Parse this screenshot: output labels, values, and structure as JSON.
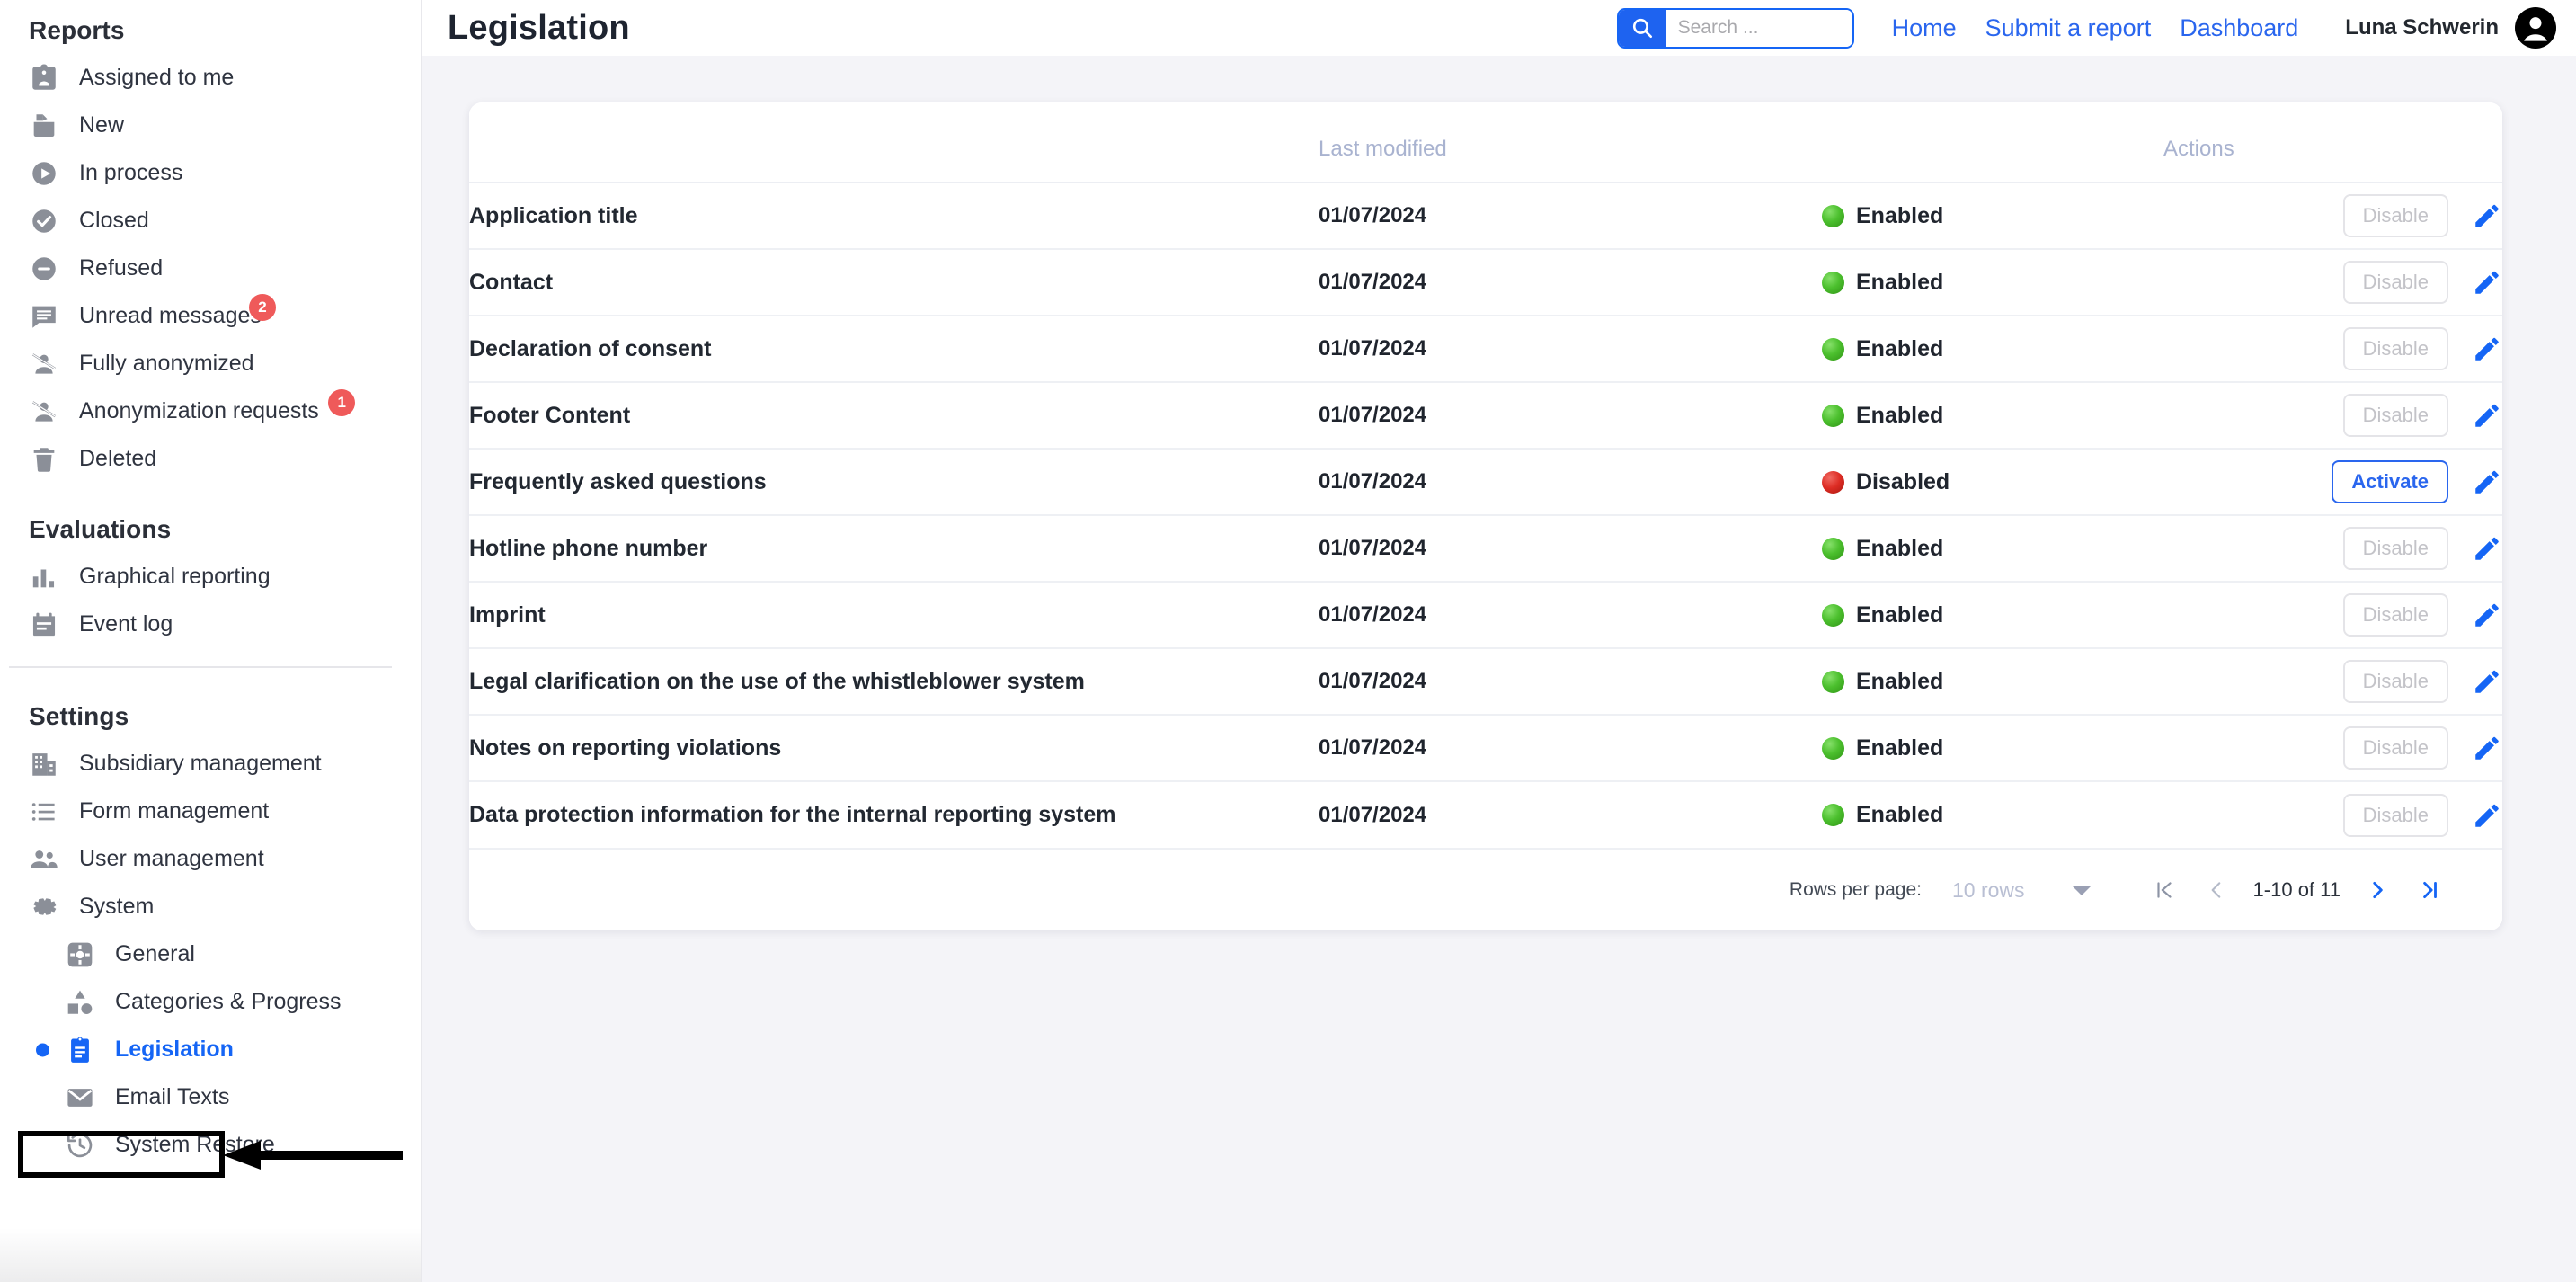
{
  "sidebar": {
    "sections": [
      {
        "heading": "Reports",
        "items": [
          {
            "label": "Assigned to me",
            "icon": "assigned-badge-icon"
          },
          {
            "label": "New",
            "icon": "inbox-new-icon"
          },
          {
            "label": "In process",
            "icon": "play-circle-icon"
          },
          {
            "label": "Closed",
            "icon": "check-circle-icon"
          },
          {
            "label": "Refused",
            "icon": "minus-circle-icon"
          },
          {
            "label": "Unread messages",
            "icon": "chat-message-icon",
            "badge": "2"
          },
          {
            "label": "Fully anonymized",
            "icon": "person-off-icon"
          },
          {
            "label": "Anonymization requests",
            "icon": "person-off-icon",
            "badge": "1"
          },
          {
            "label": "Deleted",
            "icon": "trash-icon"
          }
        ]
      },
      {
        "heading": "Evaluations",
        "items": [
          {
            "label": "Graphical reporting",
            "icon": "bar-chart-icon"
          },
          {
            "label": "Event log",
            "icon": "event-log-icon"
          }
        ]
      },
      {
        "heading": "Settings",
        "items": [
          {
            "label": "Subsidiary management",
            "icon": "building-icon"
          },
          {
            "label": "Form management",
            "icon": "list-icon"
          },
          {
            "label": "User management",
            "icon": "people-icon"
          },
          {
            "label": "System",
            "icon": "gear-icon"
          },
          {
            "label": "General",
            "icon": "settings-square-icon",
            "sub": true
          },
          {
            "label": "Categories & Progress",
            "icon": "shapes-icon",
            "sub": true
          },
          {
            "label": "Legislation",
            "icon": "clipboard-icon",
            "sub": true,
            "active": true
          },
          {
            "label": "Email Texts",
            "icon": "envelope-icon",
            "sub": true
          },
          {
            "label": "System Restore",
            "icon": "history-restore-icon",
            "sub": true
          }
        ]
      }
    ]
  },
  "header": {
    "title": "Legislation",
    "search": {
      "placeholder": "Search ...",
      "value": "",
      "icon": "search-icon"
    },
    "nav": [
      {
        "label": "Home"
      },
      {
        "label": "Submit a report"
      },
      {
        "label": "Dashboard"
      }
    ],
    "user": {
      "name": "Luna Schwerin",
      "avatar_icon": "account-circle-icon"
    }
  },
  "table": {
    "columns": [
      "",
      "Last modified",
      "",
      "Actions"
    ],
    "rows": [
      {
        "name": "Application title",
        "modified": "01/07/2024",
        "status": "Enabled",
        "status_color": "green",
        "action": "Disable",
        "action_state": "disabled",
        "edit_icon": "pencil-icon"
      },
      {
        "name": "Contact",
        "modified": "01/07/2024",
        "status": "Enabled",
        "status_color": "green",
        "action": "Disable",
        "action_state": "disabled",
        "edit_icon": "pencil-icon"
      },
      {
        "name": "Declaration of consent",
        "modified": "01/07/2024",
        "status": "Enabled",
        "status_color": "green",
        "action": "Disable",
        "action_state": "disabled",
        "edit_icon": "pencil-icon"
      },
      {
        "name": "Footer Content",
        "modified": "01/07/2024",
        "status": "Enabled",
        "status_color": "green",
        "action": "Disable",
        "action_state": "disabled",
        "edit_icon": "pencil-icon"
      },
      {
        "name": "Frequently asked questions",
        "modified": "01/07/2024",
        "status": "Disabled",
        "status_color": "red",
        "action": "Activate",
        "action_state": "active",
        "edit_icon": "pencil-icon"
      },
      {
        "name": "Hotline phone number",
        "modified": "01/07/2024",
        "status": "Enabled",
        "status_color": "green",
        "action": "Disable",
        "action_state": "disabled",
        "edit_icon": "pencil-icon"
      },
      {
        "name": "Imprint",
        "modified": "01/07/2024",
        "status": "Enabled",
        "status_color": "green",
        "action": "Disable",
        "action_state": "disabled",
        "edit_icon": "pencil-icon"
      },
      {
        "name": "Legal clarification on the use of the whistleblower system",
        "modified": "01/07/2024",
        "status": "Enabled",
        "status_color": "green",
        "action": "Disable",
        "action_state": "disabled",
        "edit_icon": "pencil-icon"
      },
      {
        "name": "Notes on reporting violations",
        "modified": "01/07/2024",
        "status": "Enabled",
        "status_color": "green",
        "action": "Disable",
        "action_state": "disabled",
        "edit_icon": "pencil-icon"
      },
      {
        "name": "Data protection information for the internal reporting system",
        "modified": "01/07/2024",
        "status": "Enabled",
        "status_color": "green",
        "action": "Disable",
        "action_state": "disabled",
        "edit_icon": "pencil-icon"
      }
    ]
  },
  "pagination": {
    "rows_per_page_label": "Rows per page:",
    "rows_per_page_value": "10 rows",
    "range": "1-10 of 11",
    "first_icon": "first-page-icon",
    "prev_icon": "chevron-left-icon",
    "next_icon": "chevron-right-icon",
    "last_icon": "last-page-icon"
  },
  "annotation": {
    "target": "Legislation",
    "shape": "highlight-box-with-arrow"
  },
  "colors": {
    "accent": "#1565f5",
    "link": "#2a66ee",
    "enabled": "#39a617",
    "disabled": "#d32a22",
    "badge": "#ef5a5a",
    "content_bg": "#f4f4f8"
  }
}
